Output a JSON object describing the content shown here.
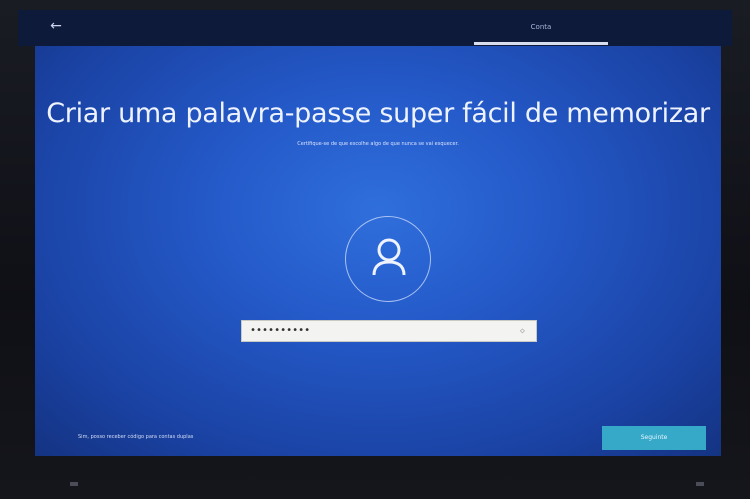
{
  "topbar": {
    "back_label": "←",
    "tab_label": "Conta"
  },
  "main": {
    "title": "Criar uma palavra-passe super fácil de memorizar",
    "subtitle": "Certifique-se de que escolhe algo de que nunca se vai esquecer.",
    "password_value": "••••••••••",
    "reveal_icon": "◇"
  },
  "footer": {
    "link_text": "Sim, posso receber código para contas duplas",
    "next_label": "Seguinte"
  },
  "colors": {
    "screen_blue": "#2459c8",
    "button_teal": "#36a8c8",
    "input_bg": "#f3f3f1"
  },
  "icons": {
    "avatar": "user-icon",
    "back": "back-arrow-icon"
  }
}
